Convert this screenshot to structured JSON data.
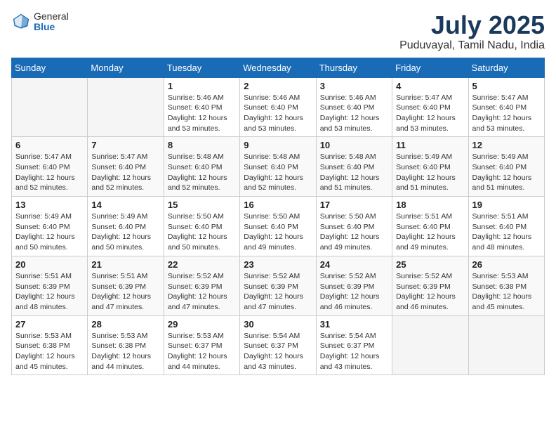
{
  "logo": {
    "general": "General",
    "blue": "Blue"
  },
  "title": "July 2025",
  "subtitle": "Puduvayal, Tamil Nadu, India",
  "days_of_week": [
    "Sunday",
    "Monday",
    "Tuesday",
    "Wednesday",
    "Thursday",
    "Friday",
    "Saturday"
  ],
  "weeks": [
    [
      {
        "day": "",
        "info": ""
      },
      {
        "day": "",
        "info": ""
      },
      {
        "day": "1",
        "info": "Sunrise: 5:46 AM\nSunset: 6:40 PM\nDaylight: 12 hours and 53 minutes."
      },
      {
        "day": "2",
        "info": "Sunrise: 5:46 AM\nSunset: 6:40 PM\nDaylight: 12 hours and 53 minutes."
      },
      {
        "day": "3",
        "info": "Sunrise: 5:46 AM\nSunset: 6:40 PM\nDaylight: 12 hours and 53 minutes."
      },
      {
        "day": "4",
        "info": "Sunrise: 5:47 AM\nSunset: 6:40 PM\nDaylight: 12 hours and 53 minutes."
      },
      {
        "day": "5",
        "info": "Sunrise: 5:47 AM\nSunset: 6:40 PM\nDaylight: 12 hours and 53 minutes."
      }
    ],
    [
      {
        "day": "6",
        "info": "Sunrise: 5:47 AM\nSunset: 6:40 PM\nDaylight: 12 hours and 52 minutes."
      },
      {
        "day": "7",
        "info": "Sunrise: 5:47 AM\nSunset: 6:40 PM\nDaylight: 12 hours and 52 minutes."
      },
      {
        "day": "8",
        "info": "Sunrise: 5:48 AM\nSunset: 6:40 PM\nDaylight: 12 hours and 52 minutes."
      },
      {
        "day": "9",
        "info": "Sunrise: 5:48 AM\nSunset: 6:40 PM\nDaylight: 12 hours and 52 minutes."
      },
      {
        "day": "10",
        "info": "Sunrise: 5:48 AM\nSunset: 6:40 PM\nDaylight: 12 hours and 51 minutes."
      },
      {
        "day": "11",
        "info": "Sunrise: 5:49 AM\nSunset: 6:40 PM\nDaylight: 12 hours and 51 minutes."
      },
      {
        "day": "12",
        "info": "Sunrise: 5:49 AM\nSunset: 6:40 PM\nDaylight: 12 hours and 51 minutes."
      }
    ],
    [
      {
        "day": "13",
        "info": "Sunrise: 5:49 AM\nSunset: 6:40 PM\nDaylight: 12 hours and 50 minutes."
      },
      {
        "day": "14",
        "info": "Sunrise: 5:49 AM\nSunset: 6:40 PM\nDaylight: 12 hours and 50 minutes."
      },
      {
        "day": "15",
        "info": "Sunrise: 5:50 AM\nSunset: 6:40 PM\nDaylight: 12 hours and 50 minutes."
      },
      {
        "day": "16",
        "info": "Sunrise: 5:50 AM\nSunset: 6:40 PM\nDaylight: 12 hours and 49 minutes."
      },
      {
        "day": "17",
        "info": "Sunrise: 5:50 AM\nSunset: 6:40 PM\nDaylight: 12 hours and 49 minutes."
      },
      {
        "day": "18",
        "info": "Sunrise: 5:51 AM\nSunset: 6:40 PM\nDaylight: 12 hours and 49 minutes."
      },
      {
        "day": "19",
        "info": "Sunrise: 5:51 AM\nSunset: 6:40 PM\nDaylight: 12 hours and 48 minutes."
      }
    ],
    [
      {
        "day": "20",
        "info": "Sunrise: 5:51 AM\nSunset: 6:39 PM\nDaylight: 12 hours and 48 minutes."
      },
      {
        "day": "21",
        "info": "Sunrise: 5:51 AM\nSunset: 6:39 PM\nDaylight: 12 hours and 47 minutes."
      },
      {
        "day": "22",
        "info": "Sunrise: 5:52 AM\nSunset: 6:39 PM\nDaylight: 12 hours and 47 minutes."
      },
      {
        "day": "23",
        "info": "Sunrise: 5:52 AM\nSunset: 6:39 PM\nDaylight: 12 hours and 47 minutes."
      },
      {
        "day": "24",
        "info": "Sunrise: 5:52 AM\nSunset: 6:39 PM\nDaylight: 12 hours and 46 minutes."
      },
      {
        "day": "25",
        "info": "Sunrise: 5:52 AM\nSunset: 6:39 PM\nDaylight: 12 hours and 46 minutes."
      },
      {
        "day": "26",
        "info": "Sunrise: 5:53 AM\nSunset: 6:38 PM\nDaylight: 12 hours and 45 minutes."
      }
    ],
    [
      {
        "day": "27",
        "info": "Sunrise: 5:53 AM\nSunset: 6:38 PM\nDaylight: 12 hours and 45 minutes."
      },
      {
        "day": "28",
        "info": "Sunrise: 5:53 AM\nSunset: 6:38 PM\nDaylight: 12 hours and 44 minutes."
      },
      {
        "day": "29",
        "info": "Sunrise: 5:53 AM\nSunset: 6:37 PM\nDaylight: 12 hours and 44 minutes."
      },
      {
        "day": "30",
        "info": "Sunrise: 5:54 AM\nSunset: 6:37 PM\nDaylight: 12 hours and 43 minutes."
      },
      {
        "day": "31",
        "info": "Sunrise: 5:54 AM\nSunset: 6:37 PM\nDaylight: 12 hours and 43 minutes."
      },
      {
        "day": "",
        "info": ""
      },
      {
        "day": "",
        "info": ""
      }
    ]
  ]
}
